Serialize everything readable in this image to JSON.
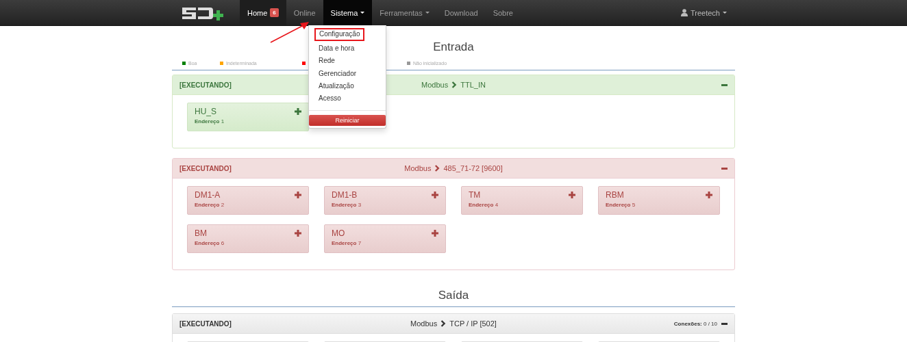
{
  "navbar": {
    "items": [
      {
        "label": "Home",
        "badge": "6",
        "selected": true,
        "dropdown": false
      },
      {
        "label": "Online",
        "selected": false,
        "dropdown": false
      },
      {
        "label": "Sistema",
        "selected": false,
        "open": true,
        "dropdown": true
      },
      {
        "label": "Ferramentas",
        "selected": false,
        "dropdown": true
      },
      {
        "label": "Download",
        "selected": false,
        "dropdown": false
      },
      {
        "label": "Sobre",
        "selected": false,
        "dropdown": false
      }
    ],
    "user": "Treetech"
  },
  "menu": {
    "items": [
      {
        "label": "Configuração",
        "highlighted": true
      },
      {
        "label": "Data e hora",
        "highlighted": false
      },
      {
        "label": "Rede",
        "highlighted": false
      },
      {
        "label": "Gerenciador",
        "highlighted": false
      },
      {
        "label": "Atualização",
        "highlighted": false
      },
      {
        "label": "Acesso",
        "highlighted": false
      }
    ],
    "button": "Reiniciar"
  },
  "sections": [
    {
      "title": "Entrada",
      "legend": [
        {
          "label": "Boa",
          "color": "#008000"
        },
        {
          "label": "Indeterminada",
          "color": "#ffa500"
        },
        {
          "color": "#ff0000"
        },
        {
          "label": "Não inicializado",
          "color": "#999999"
        }
      ],
      "panels": [
        {
          "kind": "success",
          "state": "[EXECUTANDO]",
          "protocol": "Modbus",
          "port": "TTL_IN",
          "devices": [
            {
              "name": "HU_S",
              "address_label": "Endereço",
              "address": "1"
            }
          ]
        },
        {
          "kind": "danger",
          "state": "[EXECUTANDO]",
          "protocol": "Modbus",
          "port": "485_71-72 [9600]",
          "devices": [
            {
              "name": "DM1-A",
              "address_label": "Endereço",
              "address": "2"
            },
            {
              "name": "DM1-B",
              "address_label": "Endereço",
              "address": "3"
            },
            {
              "name": "TM",
              "address_label": "Endereço",
              "address": "4"
            },
            {
              "name": "RBM",
              "address_label": "Endereço",
              "address": "5"
            },
            {
              "name": "BM",
              "address_label": "Endereço",
              "address": "6"
            },
            {
              "name": "MO",
              "address_label": "Endereço",
              "address": "7"
            }
          ]
        }
      ]
    },
    {
      "title": "Saída",
      "panels": [
        {
          "kind": "default",
          "state": "[EXECUTANDO]",
          "protocol": "Modbus",
          "port": "TCP / IP [502]",
          "connections_label": "Conexões:",
          "connections": "0 / 10",
          "devices": [
            {
              "kind": "hidden"
            },
            {
              "kind": "hidden"
            },
            {
              "kind": "hidden"
            },
            {
              "kind": "hidden"
            }
          ]
        }
      ]
    }
  ]
}
